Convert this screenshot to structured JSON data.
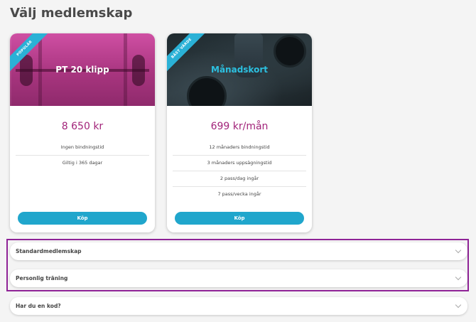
{
  "page": {
    "title": "Välj medlemskap"
  },
  "cards": [
    {
      "badge": "POPULÄR",
      "name": "PT 20 klipp",
      "price": "8 650 kr",
      "features": [
        "Ingen bindningstid",
        "Giltig i 365 dagar"
      ],
      "button": "Köp"
    },
    {
      "badge": "BÄST VÄRDE",
      "name": "Månadskort",
      "price": "699 kr/mån",
      "features": [
        "12 månaders bindningstid",
        "3 månaders uppsägningstid",
        "2 pass/dag ingår",
        "7 pass/vecka ingår"
      ],
      "button": "Köp"
    }
  ],
  "accordions": [
    {
      "label": "Standardmedlemskap",
      "icon": "chevron-down-icon"
    },
    {
      "label": "Personlig träning",
      "icon": "chevron-down-icon"
    },
    {
      "label": "Har du en kod?",
      "icon": "chevron-down-icon"
    }
  ],
  "colors": {
    "price": "#a2247a",
    "button": "#20a6cc",
    "badge": "#2ab1d6",
    "highlight": "#8f2396"
  }
}
